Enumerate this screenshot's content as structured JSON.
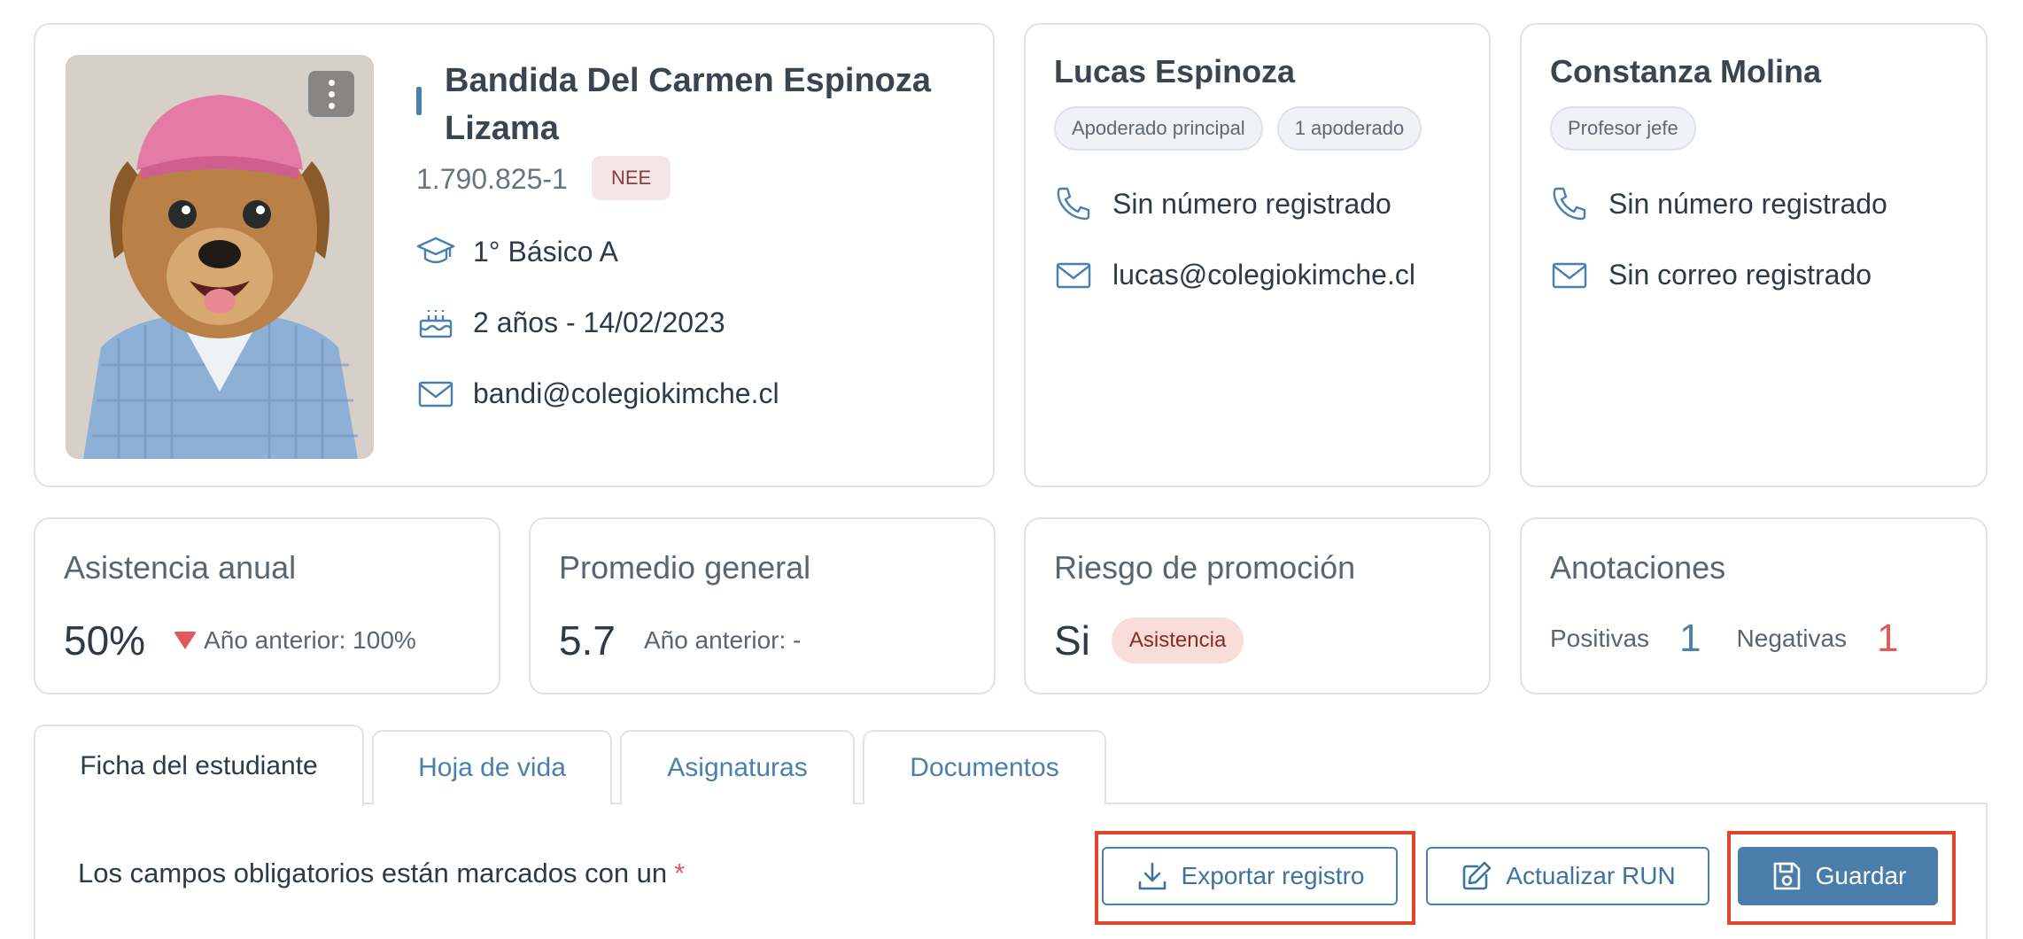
{
  "student": {
    "name": "Bandida Del Carmen Espinoza Lizama",
    "run": "1.790.825-1",
    "badge": "NEE",
    "course": "1° Básico A",
    "age_birth": "2 años - 14/02/2023",
    "email": "bandi@colegiokimche.cl"
  },
  "guardian": {
    "name": "Lucas Espinoza",
    "chips": [
      "Apoderado principal",
      "1 apoderado"
    ],
    "phone": "Sin número registrado",
    "email": "lucas@colegiokimche.cl"
  },
  "teacher": {
    "name": "Constanza Molina",
    "chips": [
      "Profesor jefe"
    ],
    "phone": "Sin número registrado",
    "email": "Sin correo registrado"
  },
  "metrics": {
    "attendance": {
      "title": "Asistencia anual",
      "value": "50%",
      "previous": "Año anterior: 100%"
    },
    "average": {
      "title": "Promedio general",
      "value": "5.7",
      "previous": "Año anterior: -"
    },
    "risk": {
      "title": "Riesgo de promoción",
      "value": "Si",
      "badge": "Asistencia"
    },
    "annotations": {
      "title": "Anotaciones",
      "positive_label": "Positivas",
      "positive_count": "1",
      "negative_label": "Negativas",
      "negative_count": "1"
    }
  },
  "tabs": [
    {
      "label": "Ficha del estudiante"
    },
    {
      "label": "Hoja de vida"
    },
    {
      "label": "Asignaturas"
    },
    {
      "label": "Documentos"
    }
  ],
  "form": {
    "required_note": "Los campos obligatorios están marcados con un",
    "required_marker": "*"
  },
  "actions": {
    "export_label": "Exportar registro",
    "update_run_label": "Actualizar RUN",
    "save_label": "Guardar"
  },
  "colors": {
    "accent": "#4a80ad",
    "negative": "#e05a5a",
    "highlight": "#e0452e"
  },
  "icons": [
    "kebab-menu-icon",
    "graduation-cap-icon",
    "cake-icon",
    "mail-icon",
    "phone-icon",
    "download-icon",
    "edit-icon",
    "save-icon"
  ]
}
